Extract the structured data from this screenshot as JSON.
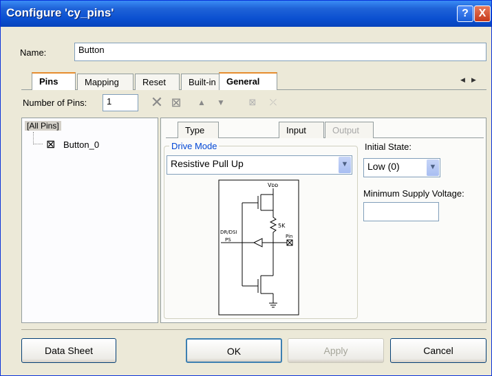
{
  "window": {
    "title": "Configure 'cy_pins'",
    "help": "?",
    "close": "X"
  },
  "name": {
    "label": "Name:",
    "value": "Button"
  },
  "tabs": [
    "Pins",
    "Mapping",
    "Reset",
    "Built-in"
  ],
  "tab_scroll": {
    "left": "◀",
    "right": "▶"
  },
  "pins": {
    "label": "Number of Pins:",
    "value": "1"
  },
  "tree": {
    "root": "[All Pins]",
    "child": "Button_0"
  },
  "subtabs": [
    "Type",
    "General",
    "Input",
    "Output"
  ],
  "drive_mode": {
    "label": "Drive Mode",
    "value": "Resistive Pull Up"
  },
  "initial_state": {
    "label": "Initial State:",
    "value": "Low (0)"
  },
  "min_supply": {
    "label": "Minimum Supply Voltage:",
    "value": ""
  },
  "diagram": {
    "vdd": "Vᴅᴅ",
    "res": "5K",
    "drdsi": "DR/DSI",
    "ps": "PS",
    "pin": "Pin"
  },
  "buttons": {
    "datasheet": "Data Sheet",
    "ok": "OK",
    "apply": "Apply",
    "cancel": "Cancel"
  }
}
